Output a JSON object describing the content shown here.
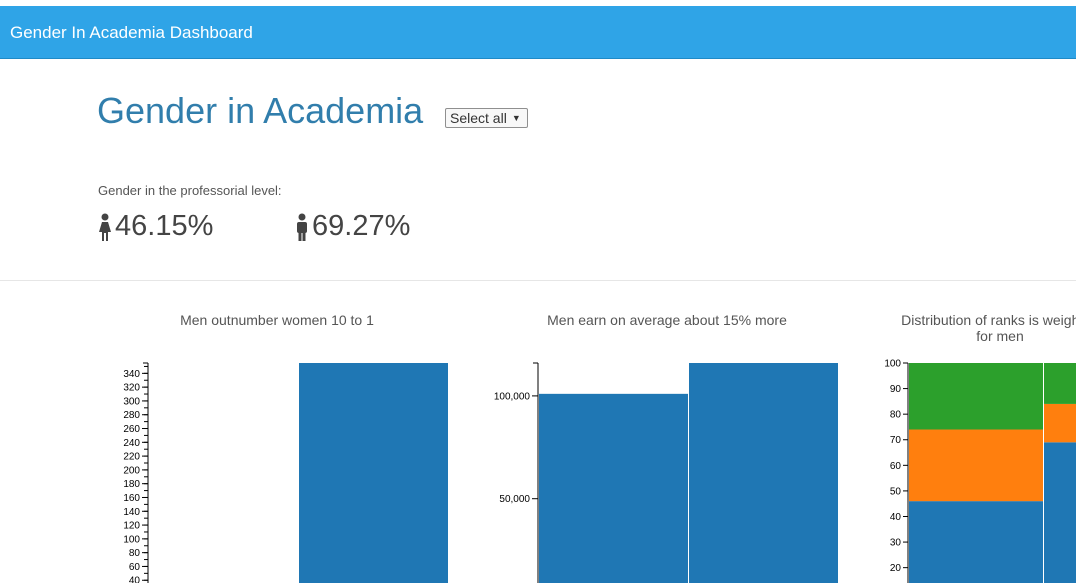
{
  "navbar": {
    "brand": "Gender In Academia Dashboard"
  },
  "header": {
    "title": "Gender in Academia",
    "select_value": "Select all"
  },
  "stats": {
    "label": "Gender in the professorial level:",
    "women_value": "46.15%",
    "men_value": "69.27%",
    "women_icon": "female-icon",
    "men_icon": "male-icon"
  },
  "colors": {
    "navbar": "#2fa4e7",
    "title": "#317eac",
    "blue": "#1f77b4",
    "orange": "#ff7f0e",
    "green": "#2ca02c"
  },
  "chart_data": [
    {
      "type": "bar",
      "title": "Men outnumber women 10 to 1",
      "categories": [
        "",
        ""
      ],
      "values": [
        0,
        355
      ],
      "ylim": [
        0,
        355
      ],
      "yticks": [
        340,
        320,
        300,
        280,
        260,
        240,
        220,
        200,
        180,
        160,
        140,
        120,
        100,
        80,
        60,
        40
      ],
      "ytick_labels": [
        "340",
        "320",
        "300",
        "280",
        "260",
        "240",
        "220",
        "200",
        "180",
        "160",
        "140",
        "120",
        "100",
        "80",
        "60",
        "40"
      ],
      "minor_step": 10,
      "visible_range": [
        36,
        355
      ]
    },
    {
      "type": "bar",
      "title": "Men earn on average about 15% more",
      "categories": [
        "",
        ""
      ],
      "values": [
        101000,
        116000
      ],
      "ylim": [
        0,
        116000
      ],
      "yticks": [
        100000,
        50000
      ],
      "ytick_labels": [
        "100,000",
        "50,000"
      ],
      "visible_range": [
        9000,
        116000
      ]
    },
    {
      "type": "bar",
      "stacked": true,
      "title": "Distribution of ranks is weighted for men",
      "title_lines": [
        "Distribution of ranks is weighted",
        "for men"
      ],
      "categories": [
        "",
        ""
      ],
      "series": [
        {
          "values": [
            46,
            69
          ]
        },
        {
          "values": [
            28,
            15
          ]
        },
        {
          "values": [
            26,
            16
          ]
        }
      ],
      "ylim": [
        0,
        100
      ],
      "yticks": [
        100,
        90,
        80,
        70,
        60,
        50,
        40,
        30,
        20
      ],
      "ytick_labels": [
        "100",
        "90",
        "80",
        "70",
        "60",
        "50",
        "40",
        "30",
        "20"
      ],
      "visible_range": [
        14,
        100
      ]
    }
  ]
}
